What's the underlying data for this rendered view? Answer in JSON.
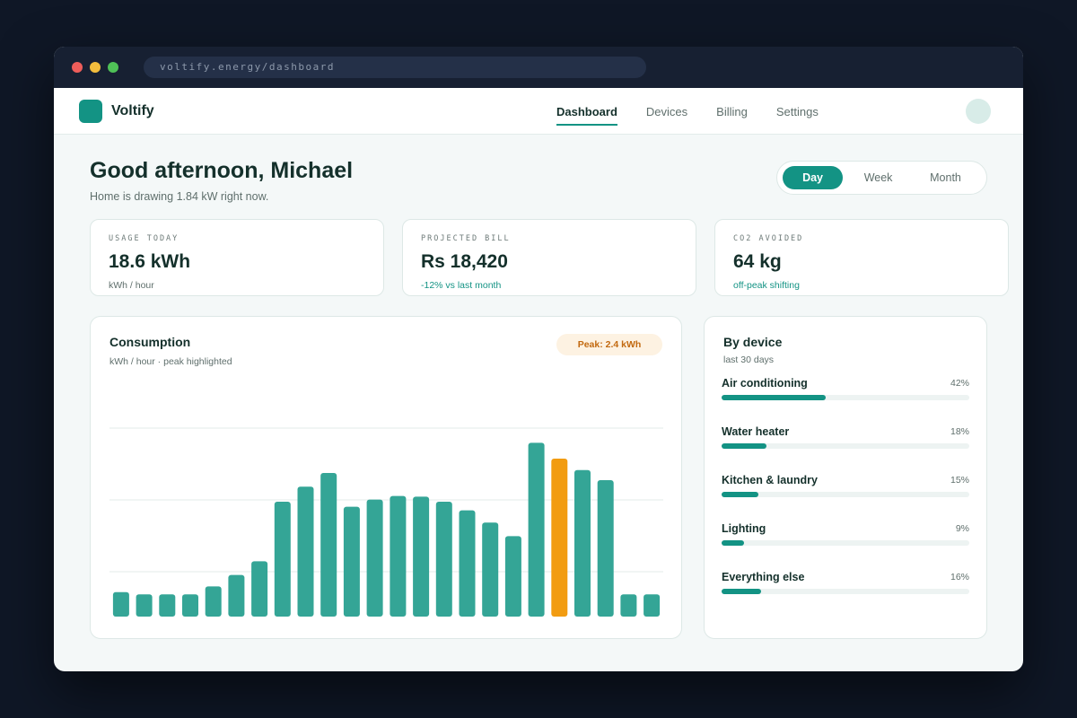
{
  "browser": {
    "url": "voltify.energy/dashboard"
  },
  "nav": {
    "brand": "Voltify",
    "links": [
      "Dashboard",
      "Devices",
      "Billing",
      "Settings"
    ],
    "active": "Dashboard"
  },
  "header": {
    "greeting": "Good afternoon, Michael",
    "subtitle": "Home is drawing 1.84 kW right now.",
    "ranges": [
      "Day",
      "Week",
      "Month"
    ],
    "active_range": "Day"
  },
  "stats": [
    {
      "label": "USAGE TODAY",
      "value": "18.6 kWh",
      "sub": "kWh / hour",
      "accent": false
    },
    {
      "label": "PROJECTED BILL",
      "value": "Rs 18,420",
      "sub": "-12% vs last month",
      "accent": true
    },
    {
      "label": "CO2 AVOIDED",
      "value": "64 kg",
      "sub": "off-peak shifting",
      "accent": true
    }
  ],
  "consumption": {
    "title": "Consumption",
    "subtitle": "kWh / hour · peak highlighted",
    "peak_label": "Peak: 2.4 kWh"
  },
  "chart_data": {
    "type": "bar",
    "categories": [
      "",
      "",
      "",
      "",
      "",
      "",
      "",
      "",
      "",
      "",
      "",
      "",
      "",
      "",
      "",
      "",
      "",
      "",
      "",
      "",
      "",
      "",
      "",
      ""
    ],
    "values": [
      0.34,
      0.31,
      0.31,
      0.31,
      0.42,
      0.58,
      0.77,
      1.6,
      1.81,
      2.0,
      1.53,
      1.63,
      1.68,
      1.67,
      1.6,
      1.48,
      1.31,
      1.12,
      2.42,
      2.2,
      2.04,
      1.9,
      0.31,
      0.31
    ],
    "highlight_index": 19,
    "ylim": [
      0,
      3.0
    ],
    "grid": true,
    "colors": {
      "bar": "#34a596",
      "highlight": "#f29c11",
      "grid": "#e3ebea"
    }
  },
  "devices": {
    "title": "By device",
    "subtitle": "last 30 days",
    "items": [
      {
        "name": "Air conditioning",
        "pct_label": "42%",
        "pct": 42
      },
      {
        "name": "Water heater",
        "pct_label": "18%",
        "pct": 18
      },
      {
        "name": "Kitchen & laundry",
        "pct_label": "15%",
        "pct": 15
      },
      {
        "name": "Lighting",
        "pct_label": "9%",
        "pct": 9
      },
      {
        "name": "Everything else",
        "pct_label": "16%",
        "pct": 16
      }
    ]
  },
  "colors": {
    "accent": "#139384",
    "peak": "#f29c11"
  }
}
